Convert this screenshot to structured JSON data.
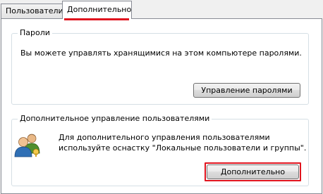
{
  "tabs": [
    {
      "label": "Пользователи",
      "active": false
    },
    {
      "label": "Дополнительно",
      "active": true
    }
  ],
  "passwords_group": {
    "title": "Пароли",
    "description": "Вы можете управлять хранящимися на этом компьютере паролями.",
    "button_label": "Управление паролями"
  },
  "users_group": {
    "title": "Дополнительное управление пользователями",
    "description_line1": "Для дополнительного управления пользователями",
    "description_line2": "используйте оснастку \"Локальные пользователи и группы\".",
    "button_label": "Дополнительно",
    "icon": "users-icon"
  },
  "colors": {
    "highlight": "#e0141e",
    "panel_bg": "#ffffff",
    "window_bg": "#f0f0f0",
    "group_border": "#d5dfe5"
  }
}
